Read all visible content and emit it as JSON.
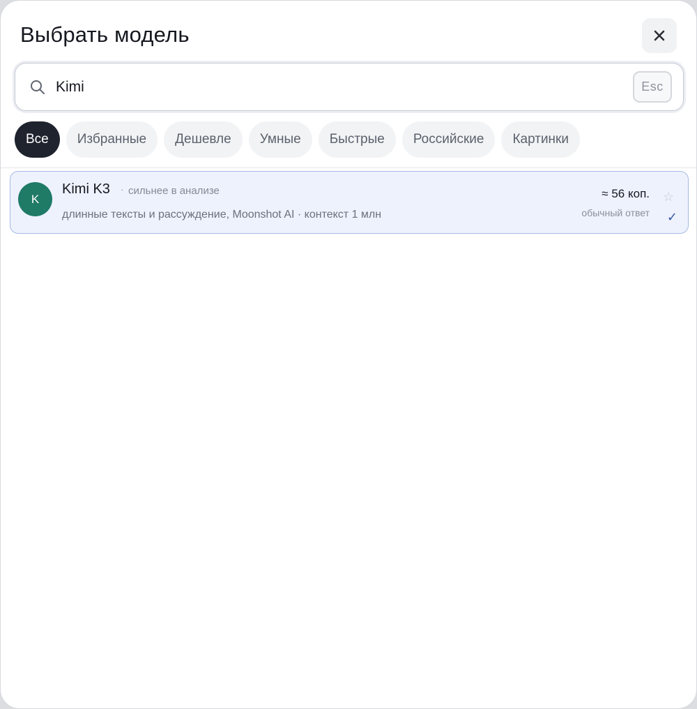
{
  "dialog": {
    "title": "Выбрать модель",
    "close_icon": "close-icon"
  },
  "search": {
    "value": "Kimi",
    "placeholder": "",
    "icon": "search-icon",
    "esc_label": "Esc"
  },
  "filters": [
    {
      "label": "Все",
      "active": true
    },
    {
      "label": "Избранные",
      "active": false
    },
    {
      "label": "Дешевле",
      "active": false
    },
    {
      "label": "Умные",
      "active": false
    },
    {
      "label": "Быстрые",
      "active": false
    },
    {
      "label": "Российские",
      "active": false
    },
    {
      "label": "Картинки",
      "active": false
    }
  ],
  "models": [
    {
      "avatar_letter": "K",
      "avatar_color": "#1f7a66",
      "name": "Kimi K3",
      "separator": "·",
      "tag": "сильнее в анализе",
      "description": "длинные тексты и рассуждение, Moonshot AI · контекст 1 млн",
      "price": "≈ 56 коп.",
      "price_note": "обычный ответ",
      "favorite_icon": "star-icon",
      "selected_icon": "check-icon",
      "selected": true
    }
  ],
  "colors": {
    "accent": "#1f232e",
    "selected_bg": "#eef2fd",
    "selected_border": "#a7b9e3",
    "check": "#3a56a8"
  }
}
